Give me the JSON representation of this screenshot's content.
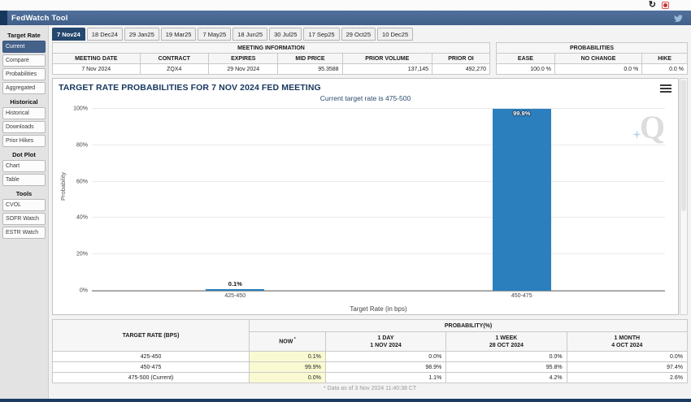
{
  "window": {
    "refresh_glyph": "↻"
  },
  "header": {
    "title": "FedWatch Tool"
  },
  "sidebar": {
    "sections": [
      {
        "title": "Target Rate",
        "items": [
          {
            "label": "Current",
            "selected": true
          },
          {
            "label": "Compare",
            "selected": false
          },
          {
            "label": "Probabilities",
            "selected": false
          },
          {
            "label": "Aggregated",
            "selected": false
          }
        ]
      },
      {
        "title": "Historical",
        "items": [
          {
            "label": "Historical",
            "selected": false
          },
          {
            "label": "Downloads",
            "selected": false
          },
          {
            "label": "Prior Hikes",
            "selected": false
          }
        ]
      },
      {
        "title": "Dot Plot",
        "items": [
          {
            "label": "Chart",
            "selected": false
          },
          {
            "label": "Table",
            "selected": false
          }
        ]
      },
      {
        "title": "Tools",
        "items": [
          {
            "label": "CVOL",
            "selected": false
          },
          {
            "label": "SOFR Watch",
            "selected": false
          },
          {
            "label": "ESTR Watch",
            "selected": false
          }
        ]
      }
    ]
  },
  "tabs": [
    {
      "label": "7 Nov24",
      "selected": true
    },
    {
      "label": "18 Dec24",
      "selected": false
    },
    {
      "label": "29 Jan25",
      "selected": false
    },
    {
      "label": "19 Mar25",
      "selected": false
    },
    {
      "label": "7 May25",
      "selected": false
    },
    {
      "label": "18 Jun25",
      "selected": false
    },
    {
      "label": "30 Jul25",
      "selected": false
    },
    {
      "label": "17 Sep25",
      "selected": false
    },
    {
      "label": "29 Oct25",
      "selected": false
    },
    {
      "label": "10 Dec25",
      "selected": false
    }
  ],
  "meeting_info": {
    "title": "MEETING INFORMATION",
    "columns": [
      "MEETING DATE",
      "CONTRACT",
      "EXPIRES",
      "MID PRICE",
      "PRIOR VOLUME",
      "PRIOR OI"
    ],
    "values": [
      "7 Nov 2024",
      "ZQX4",
      "29 Nov 2024",
      "95.3588",
      "137,145",
      "492,270"
    ]
  },
  "probabilities_summary": {
    "title": "PROBABILITIES",
    "columns": [
      "EASE",
      "NO CHANGE",
      "HIKE"
    ],
    "values": [
      "100.0 %",
      "0.0 %",
      "0.0 %"
    ]
  },
  "chart_data": {
    "type": "bar",
    "title": "TARGET RATE PROBABILITIES FOR 7 NOV 2024 FED MEETING",
    "subtitle": "Current target rate is 475-500",
    "categories": [
      "425-450",
      "450-475"
    ],
    "values": [
      0.1,
      99.9
    ],
    "bar_labels": [
      "0.1%",
      "99.9%"
    ],
    "xlabel": "Target Rate (in bps)",
    "ylabel": "Probability",
    "ylim": [
      0,
      100
    ],
    "yticks": [
      "0%",
      "20%",
      "40%",
      "60%",
      "80%",
      "100%"
    ],
    "grid": true,
    "legend": "none",
    "bar_color": "#2b7fbd"
  },
  "probability_table": {
    "corner_header": "TARGET RATE (BPS)",
    "group_header": "PROBABILITY(%)",
    "columns": [
      {
        "title": "NOW",
        "sub": "",
        "asterisk": true
      },
      {
        "title": "1 DAY",
        "sub": "1 NOV 2024",
        "asterisk": false
      },
      {
        "title": "1 WEEK",
        "sub": "28 OCT 2024",
        "asterisk": false
      },
      {
        "title": "1 MONTH",
        "sub": "4 OCT 2024",
        "asterisk": false
      }
    ],
    "rows": [
      {
        "rate": "425-450",
        "values": [
          "0.1%",
          "0.0%",
          "0.0%",
          "0.0%"
        ]
      },
      {
        "rate": "450-475",
        "values": [
          "99.9%",
          "98.9%",
          "95.8%",
          "97.4%"
        ]
      },
      {
        "rate": "475-500 (Current)",
        "values": [
          "0.0%",
          "1.1%",
          "4.2%",
          "2.6%"
        ]
      }
    ]
  },
  "footnote": "* Data as of 3 Nov 2024 11:40:38 CT",
  "watermark": {
    "letter": "Q"
  },
  "colors": {
    "accent_navy": "#17375e",
    "selected_nav": "#26486f",
    "bar_blue": "#2b7fbd",
    "now_highlight": "#fafad2"
  }
}
